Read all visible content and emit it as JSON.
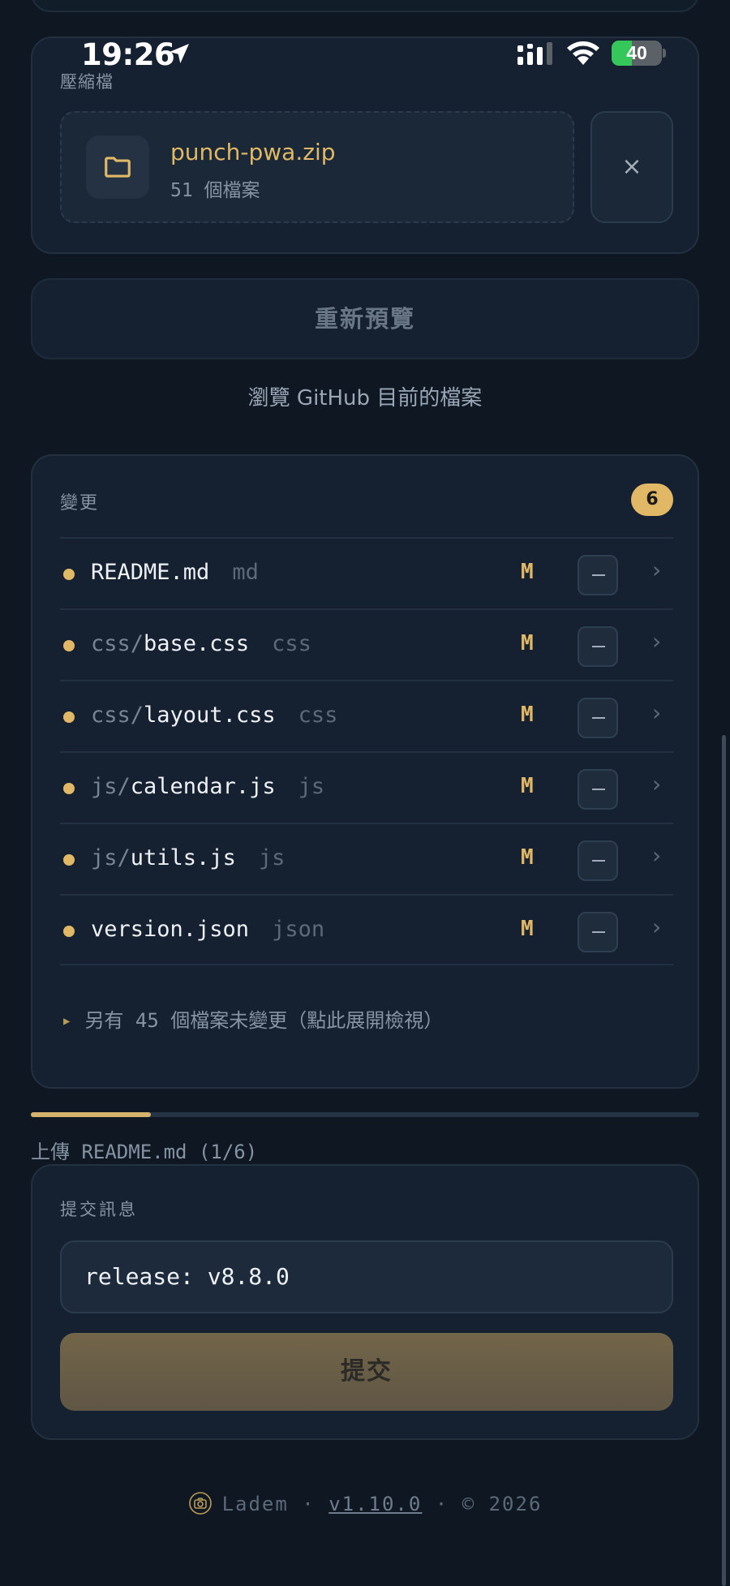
{
  "status_bar": {
    "time": "19:26",
    "battery_text": "40",
    "battery_level": 0.4
  },
  "archive": {
    "label": "壓縮檔",
    "file_name": "punch-pwa.zip",
    "file_count": "51 個檔案",
    "remove_label": "×"
  },
  "repreview_label": "重新預覽",
  "browse_label": "瀏覽 GitHub 目前的檔案",
  "changes": {
    "title": "變更",
    "count": "6",
    "files": [
      {
        "dir": "",
        "name": "README.md",
        "ext": "md",
        "status": "M"
      },
      {
        "dir": "css/",
        "name": "base.css",
        "ext": "css",
        "status": "M"
      },
      {
        "dir": "css/",
        "name": "layout.css",
        "ext": "css",
        "status": "M"
      },
      {
        "dir": "js/",
        "name": "calendar.js",
        "ext": "js",
        "status": "M"
      },
      {
        "dir": "js/",
        "name": "utils.js",
        "ext": "js",
        "status": "M"
      },
      {
        "dir": "",
        "name": "version.json",
        "ext": "json",
        "status": "M"
      }
    ],
    "unchanged_text": "另有 45 個檔案未變更（點此展開檢視）"
  },
  "upload": {
    "progress_text": "上傳 README.md (1/6)",
    "progress_fraction": 0.18
  },
  "commit": {
    "label": "提交訊息",
    "message": "release: v8.8.0",
    "submit_label": "提交"
  },
  "footer": {
    "brand": "Ladem",
    "version": "v1.10.0",
    "copyright": "© 2026",
    "separator": "·"
  },
  "colors": {
    "background": "#0e1722",
    "card": "#152130",
    "accent": "#e1b866"
  }
}
